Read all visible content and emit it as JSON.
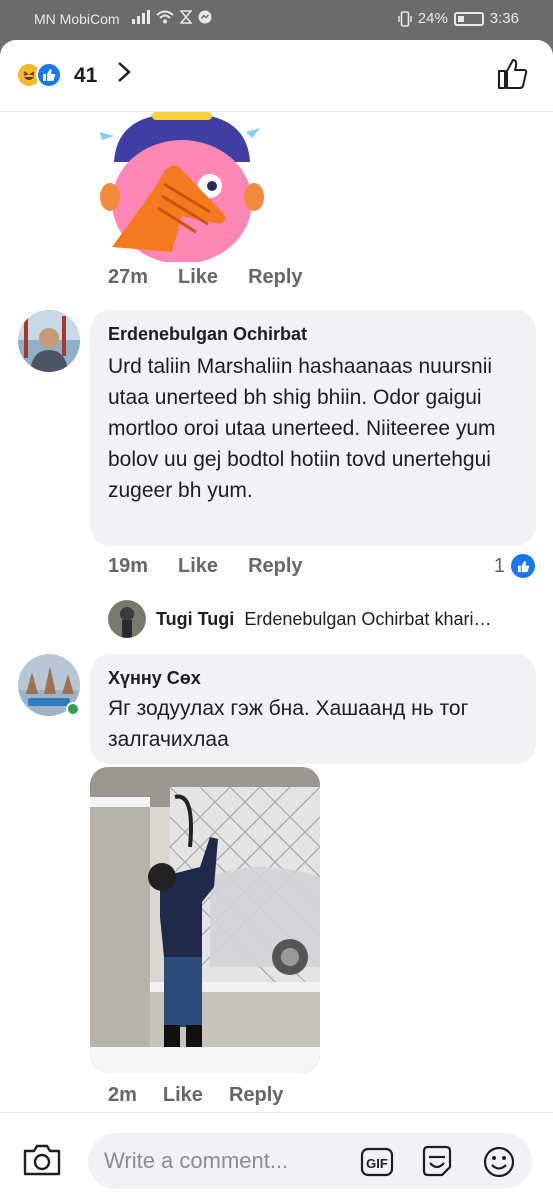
{
  "status_bar": {
    "carrier": "MN MobiCom",
    "battery": "24%",
    "time": "3:36"
  },
  "reactions": {
    "count": "41",
    "icons": [
      "haha-icon",
      "like-icon"
    ]
  },
  "comments": [
    {
      "time": "27m",
      "like": "Like",
      "reply": "Reply"
    },
    {
      "author": "Erdenebulgan Ochirbat",
      "text": "Urd taliin Marshaliin hashaanaas nuursnii utaa unerteed bh shig bhiin. Odor gaigui mortloo oroi utaa unerteed. Niiteeree yum bolov uu gej bodtol hotiin tovd unertehgui zugeer bh yum.",
      "time": "19m",
      "like": "Like",
      "reply": "Reply",
      "like_count": "1",
      "reply_preview": {
        "author": "Tugi Tugi",
        "snippet": "Erdenebulgan Ochirbat khari…"
      }
    },
    {
      "author": "Хүнну Сөх",
      "text": "Яг зодуулах гэж бна. Хашаанд нь тог залгачихлаа",
      "time": "2m",
      "like": "Like",
      "reply": "Reply"
    }
  ],
  "composer": {
    "placeholder": "Write a comment...",
    "gif_label": "GIF"
  }
}
